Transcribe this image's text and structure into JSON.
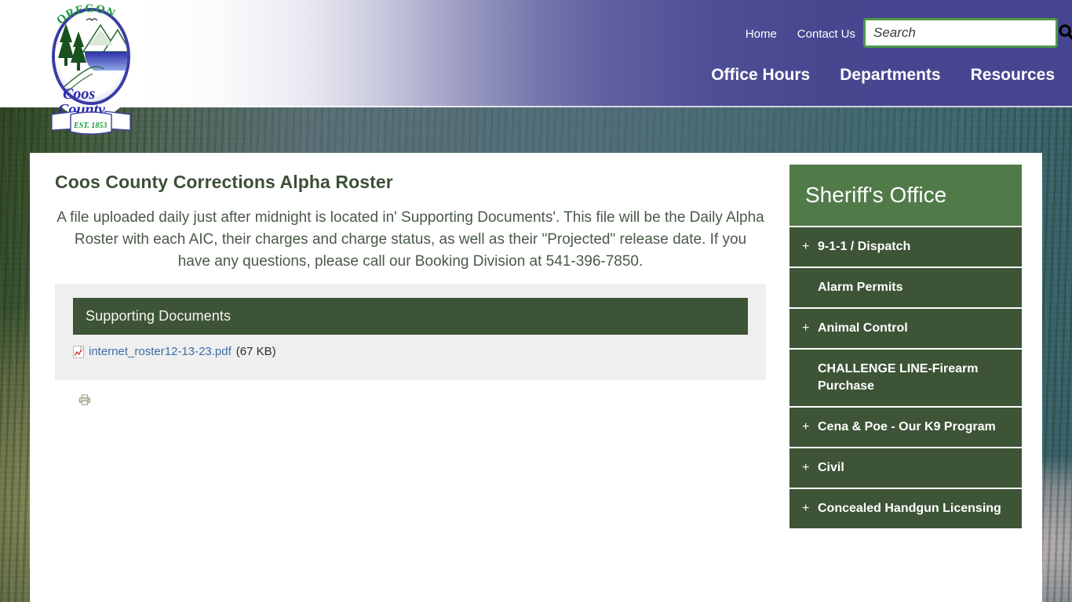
{
  "header": {
    "logo_alt": "Oregon Coos County EST. 1853 seal",
    "logo_lines": {
      "top": "OREGON",
      "name1": "Coos",
      "name2": "County",
      "banner": "EST. 1853"
    },
    "utility_nav": [
      {
        "label": "Home",
        "name": "nav-home"
      },
      {
        "label": "Contact Us",
        "name": "nav-contact-us"
      }
    ],
    "main_nav": [
      {
        "label": "Office Hours",
        "name": "nav-office-hours"
      },
      {
        "label": "Departments",
        "name": "nav-departments"
      },
      {
        "label": "Resources",
        "name": "nav-resources"
      }
    ],
    "search": {
      "placeholder": "Search",
      "value": "",
      "icon": "search-icon"
    },
    "colors": {
      "band_right": "#454590",
      "band_left": "#ffffff",
      "search_border": "#4f9a4a"
    }
  },
  "main": {
    "title": "Coos County Corrections Alpha Roster",
    "intro": "A file uploaded daily just after midnight is located in' Supporting Documents'. This file will be the Daily Alpha Roster with each AIC, their charges and charge status, as well as their \"Projected\" release date. If you have any questions, please call our Booking Division at 541-396-7850.",
    "supporting_documents": {
      "header": "Supporting Documents",
      "files": [
        {
          "name": "internet_roster12-13-23.pdf",
          "size": "(67 KB)",
          "icon": "pdf-icon"
        }
      ]
    },
    "print": {
      "icon": "printer-icon",
      "label": ""
    }
  },
  "sidebar": {
    "title": "Sheriff's Office",
    "title_color": "#517a49",
    "item_color": "#3d5436",
    "items": [
      {
        "label": "9-1-1 / Dispatch",
        "expandable": true
      },
      {
        "label": "Alarm Permits",
        "expandable": false
      },
      {
        "label": "Animal Control",
        "expandable": true
      },
      {
        "label": "CHALLENGE LINE-Firearm Purchase",
        "expandable": false
      },
      {
        "label": "Cena & Poe - Our K9 Program",
        "expandable": true
      },
      {
        "label": "Civil",
        "expandable": true
      },
      {
        "label": "Concealed Handgun Licensing",
        "expandable": true
      }
    ],
    "expand_glyph": "+"
  }
}
